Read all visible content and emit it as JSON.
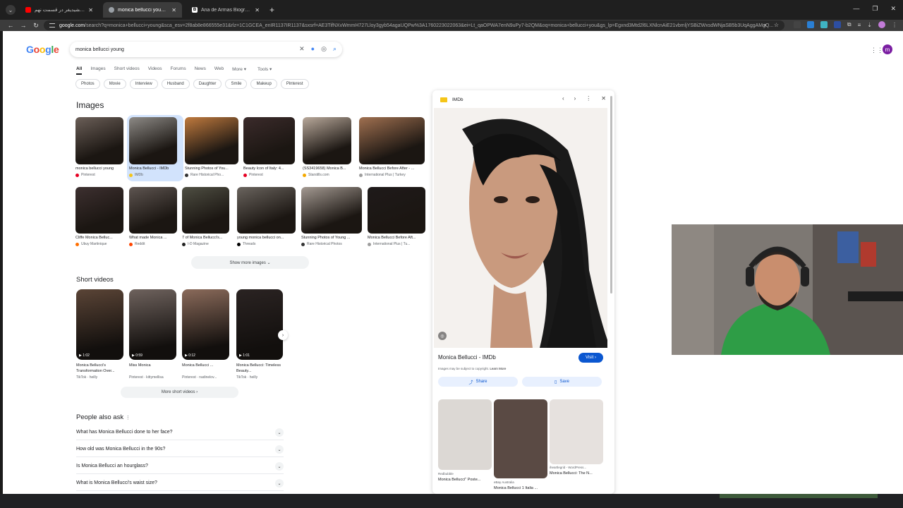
{
  "browser": {
    "tabs": [
      {
        "label": "عباس جمشیدیفر در قسمت نهم",
        "fav_color": "#ff0000",
        "active": false
      },
      {
        "label": "monica bellucci young - Googl",
        "fav_color": "#9aa0a6",
        "active": true
      },
      {
        "label": "Ana de Armas Biography, Actre",
        "fav_color": "#ffffff",
        "active": false
      }
    ],
    "fav_letter_3": "B",
    "url_host": "google.com",
    "url_rest": "/search?q=monica+bellucci+young&sca_esv=2f8ab8e866555e31&rlz=1C1GCEA_enIR1137IR1137&sxsrf=AE3TifNXvWmmH727Lloy3gyb54agaUQPw%3A1760223022063&ei=Lt_qaOPWA7enN9uPy7-b2QM&oq=monica+bellucci+you&gs_lp=Egxnd3Mtd2l6LXNlcnAiE21vbmljYSBiZWxsdWNjaSB5b3UqAggAMgQ..."
  },
  "google": {
    "search_query": "monica bellucci young",
    "avatar_letter": "m",
    "nav_tabs": [
      "All",
      "Images",
      "Short videos",
      "Videos",
      "Forums",
      "News",
      "Web",
      "More ▾",
      "Tools ▾"
    ],
    "chips": [
      "Photos",
      "Movie",
      "Interview",
      "Husband",
      "Daughter",
      "Smile",
      "Makeup",
      "Pinterest"
    ],
    "images_heading": "Images",
    "images": [
      {
        "caption": "monica bellucci young",
        "source": "Pinterest",
        "dot": "#e60023"
      },
      {
        "caption": "Monica Bellucci - IMDb",
        "source": "IMDb",
        "dot": "#f5c518"
      },
      {
        "caption": "Stunning Photos of You...",
        "source": "Rare Historical Pho...",
        "dot": "#333333"
      },
      {
        "caption": "Beauty Icon of Italy: 4...",
        "source": "Pinterest",
        "dot": "#e60023"
      },
      {
        "caption": "(SS3419658) Monica B...",
        "source": "Starstills.com",
        "dot": "#f4a900"
      },
      {
        "caption": "Monica Bellucci Before After - ...",
        "source": "International Plus | Turkey",
        "dot": "#9e9e9e"
      },
      {
        "caption": "Cliffe Monica Belluc...",
        "source": "Ubuy Martinique",
        "dot": "#ff6f00"
      },
      {
        "caption": "What made Monica ...",
        "source": "Reddit",
        "dot": "#ff4500"
      },
      {
        "caption": "7 of Monica Bellucci's...",
        "source": "I-D Magazine",
        "dot": "#222222"
      },
      {
        "caption": "young monica bellucci on...",
        "source": "Threads",
        "dot": "#000000"
      },
      {
        "caption": "Stunning Photos of Young ...",
        "source": "Rare Historical Photos",
        "dot": "#333333"
      },
      {
        "caption": "Monica Bellucci Before Aft...",
        "source": "International Plus | Tu...",
        "dot": "#9e9e9e"
      }
    ],
    "show_more": "Show more images ⌄",
    "short_videos_heading": "Short videos",
    "videos": [
      {
        "title": "Monica Bellucci's Transformation Over...",
        "source": "TikTok · heilly",
        "duration": "▶ 1:02"
      },
      {
        "title": "Miss Monica",
        "source": "Pinterest · kittymellisa",
        "duration": "▶ 0:59"
      },
      {
        "title": "Monica Bellucci ...",
        "source": "Pinterest · nadinelov...",
        "duration": "▶ 0:12"
      },
      {
        "title": "Monica Bellucci: Timeless Beauty...",
        "source": "TikTok · heilly",
        "duration": "▶ 1:01"
      }
    ],
    "more_short_videos": "More short videos ›",
    "paa_heading": "People also ask",
    "paa": [
      "What has Monica Bellucci done to her face?",
      "How old was Monica Bellucci in the 90s?",
      "Is Monica Bellucci an hourglass?",
      "What is Monica Bellucci's waist size?"
    ]
  },
  "panel": {
    "site": "IMDb",
    "title": "Monica Bellucci - IMDb",
    "visit": "Visit ›",
    "copyright": "Images may be subject to copyright.",
    "learn_more": "Learn More",
    "share": "Share",
    "save": "Save",
    "related": [
      {
        "caption": "Monica Bellucci\" Poste...",
        "source": "Redbubble"
      },
      {
        "caption": "Monica Bellucci 1 Italia ...",
        "source": "eBay Australia"
      },
      {
        "caption": "Monica Bellucci: The N...",
        "source": "iheartlegrid - WordPress..."
      }
    ]
  }
}
